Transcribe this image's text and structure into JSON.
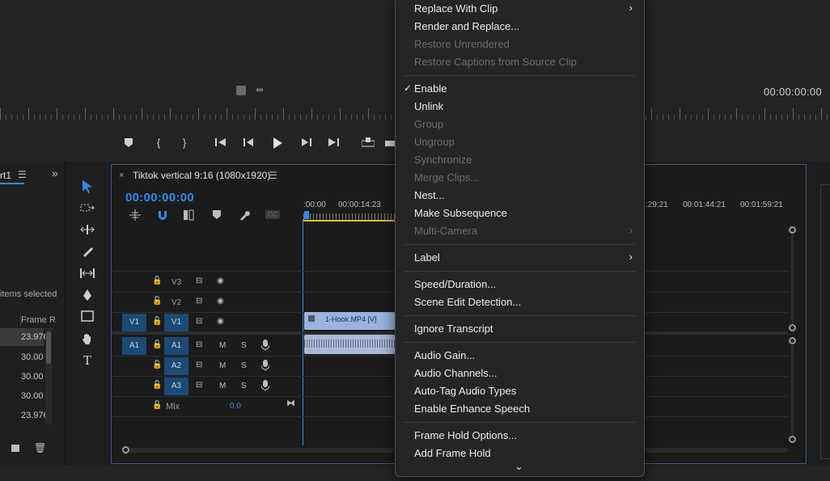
{
  "monitor": {
    "timecode": "00:00:00:00"
  },
  "project_panel": {
    "tab_label": "rt1",
    "items_selected": "items selected",
    "column_header": "Frame R",
    "rows": [
      "23.976",
      "30.00",
      "30.00",
      "30.00",
      "23.976"
    ]
  },
  "timeline": {
    "tab_title": "Tiktok vertical 9:16 (1080x1920)",
    "timecode": "00:00:00:00",
    "ruler_left": [
      ":00:00",
      "00:00:14:23"
    ],
    "ruler_right": [
      ":29:21",
      "00:01:44:21",
      "00:01:59:21"
    ],
    "tracks": {
      "v3": "V3",
      "v2": "V2",
      "v1": "V1",
      "v1_src": "V1",
      "a1": "A1",
      "a1_src": "A1",
      "a2": "A2",
      "a3": "A3",
      "m": "M",
      "s": "S",
      "mix_label": "Mix",
      "mix_value": "0.0",
      "cc": "CC"
    },
    "clip_video": "1-Hook.MP4 [V]"
  },
  "menu": {
    "items": [
      {
        "label": "Replace With Clip",
        "disabled": false,
        "submenu": true
      },
      {
        "label": "Render and Replace...",
        "disabled": false
      },
      {
        "label": "Restore Unrendered",
        "disabled": true
      },
      {
        "label": "Restore Captions from Source Clip",
        "disabled": true
      },
      {
        "label": "Enable",
        "disabled": false,
        "checked": true
      },
      {
        "label": "Unlink",
        "disabled": false
      },
      {
        "label": "Group",
        "disabled": true
      },
      {
        "label": "Ungroup",
        "disabled": true
      },
      {
        "label": "Synchronize",
        "disabled": true
      },
      {
        "label": "Merge Clips...",
        "disabled": true
      },
      {
        "label": "Nest...",
        "disabled": false
      },
      {
        "label": "Make Subsequence",
        "disabled": false
      },
      {
        "label": "Multi-Camera",
        "disabled": true,
        "submenu": true
      },
      {
        "label": "Label",
        "disabled": false,
        "submenu": true
      },
      {
        "label": "Speed/Duration...",
        "disabled": false
      },
      {
        "label": "Scene Edit Detection...",
        "disabled": false
      },
      {
        "label": "Ignore Transcript",
        "disabled": false
      },
      {
        "label": "Audio Gain...",
        "disabled": false
      },
      {
        "label": "Audio Channels...",
        "disabled": false
      },
      {
        "label": "Auto-Tag Audio Types",
        "disabled": false
      },
      {
        "label": "Enable Enhance Speech",
        "disabled": false
      },
      {
        "label": "Frame Hold Options...",
        "disabled": false
      },
      {
        "label": "Add Frame Hold",
        "disabled": false
      }
    ],
    "checkmark": "✓",
    "submenu_arrow": "›",
    "scroll_arrow": "⌄"
  },
  "colors": {
    "accent_blue": "#2d8ceb",
    "track_blue": "#1c4a77",
    "menu_bg": "#252525"
  }
}
